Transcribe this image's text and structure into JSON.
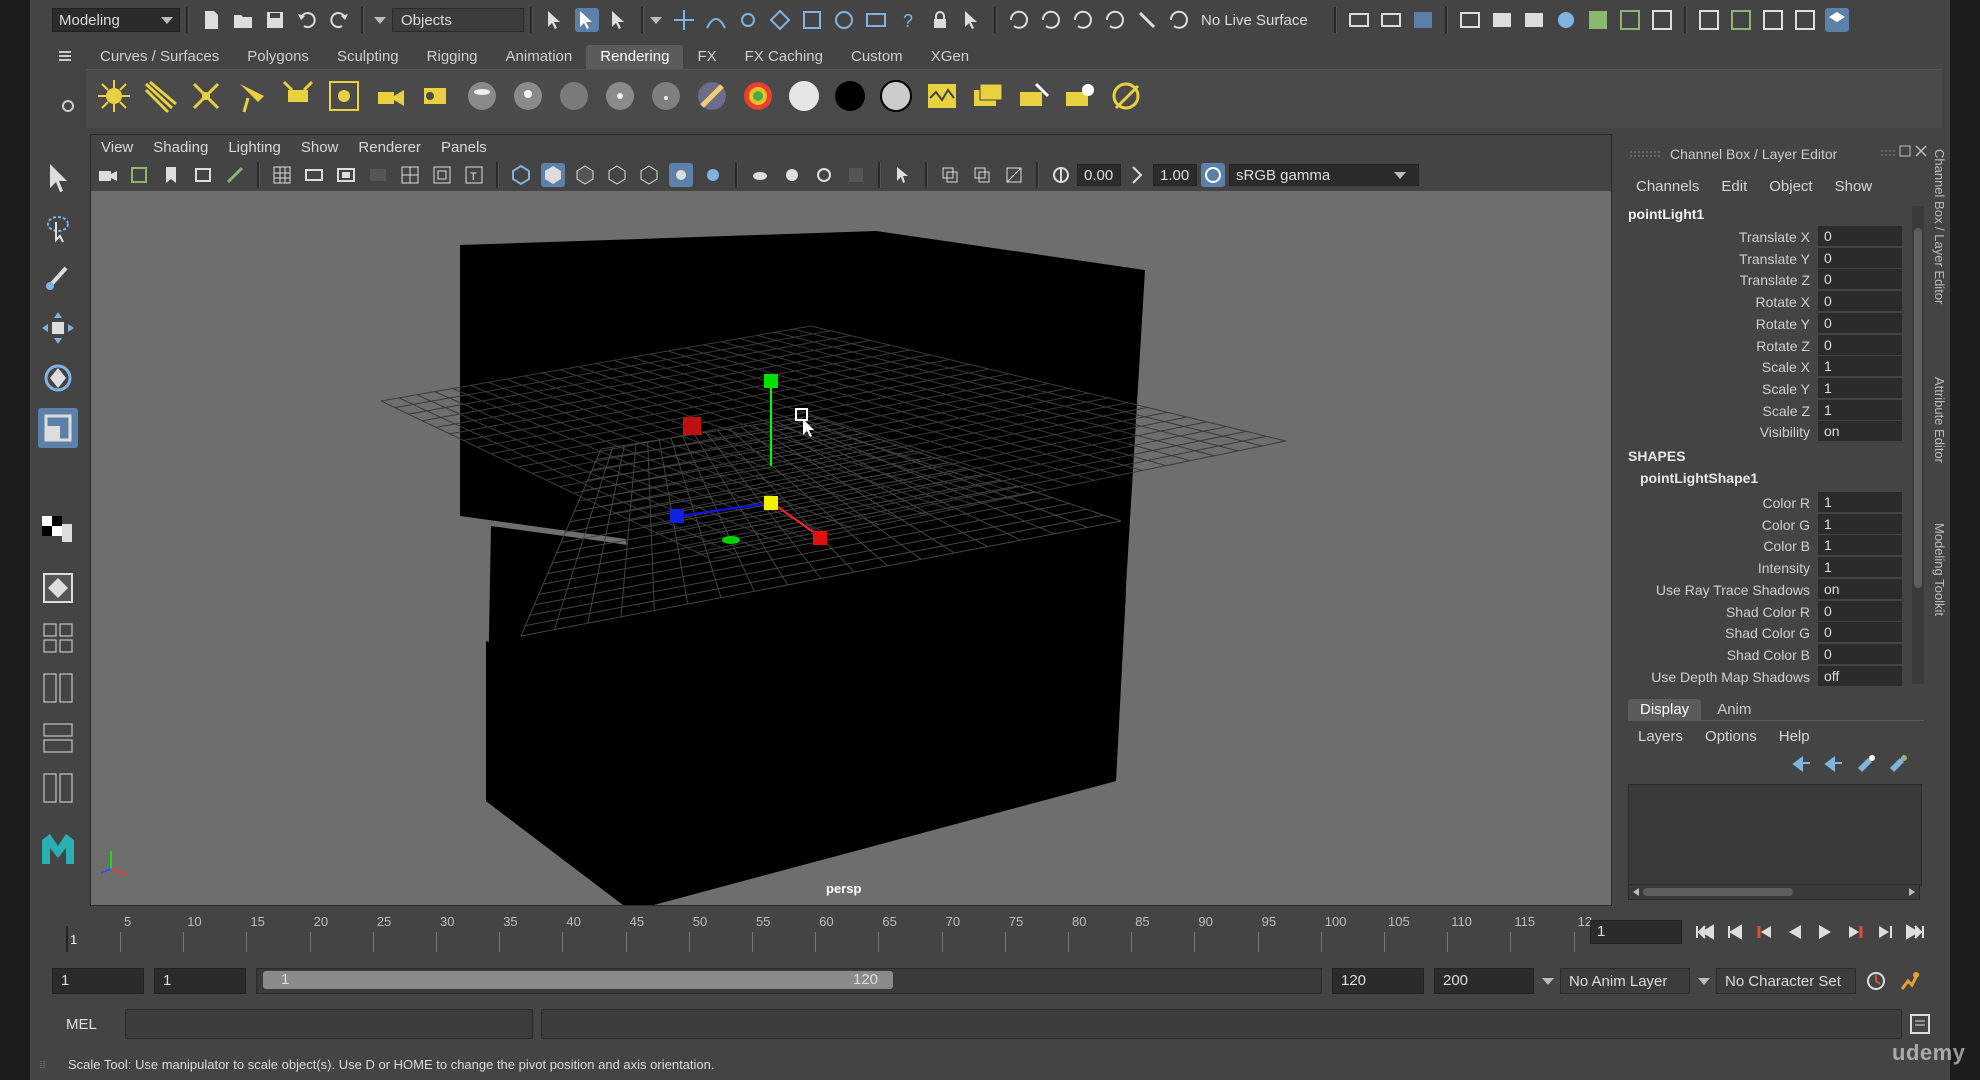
{
  "status_line": {
    "mode": "Modeling",
    "selection_mode": "Objects",
    "live_surface": "No Live Surface"
  },
  "shelf": {
    "tabs": [
      "Curves / Surfaces",
      "Polygons",
      "Sculpting",
      "Rigging",
      "Animation",
      "Rendering",
      "FX",
      "FX Caching",
      "Custom",
      "XGen"
    ],
    "active_tab": "Rendering"
  },
  "viewport": {
    "menu": [
      "View",
      "Shading",
      "Lighting",
      "Show",
      "Renderer",
      "Panels"
    ],
    "exposure": "0.00",
    "gamma": "1.00",
    "color_space": "sRGB gamma",
    "camera": "persp"
  },
  "channel_box": {
    "title": "Channel Box / Layer Editor",
    "menu": [
      "Channels",
      "Edit",
      "Object",
      "Show"
    ],
    "object": "pointLight1",
    "attributes": [
      {
        "label": "Translate X",
        "value": "0"
      },
      {
        "label": "Translate Y",
        "value": "0"
      },
      {
        "label": "Translate Z",
        "value": "0"
      },
      {
        "label": "Rotate X",
        "value": "0"
      },
      {
        "label": "Rotate Y",
        "value": "0"
      },
      {
        "label": "Rotate Z",
        "value": "0"
      },
      {
        "label": "Scale X",
        "value": "1"
      },
      {
        "label": "Scale Y",
        "value": "1"
      },
      {
        "label": "Scale Z",
        "value": "1"
      },
      {
        "label": "Visibility",
        "value": "on"
      }
    ],
    "shapes_header": "SHAPES",
    "shape_name": "pointLightShape1",
    "shape_attributes": [
      {
        "label": "Color R",
        "value": "1"
      },
      {
        "label": "Color G",
        "value": "1"
      },
      {
        "label": "Color B",
        "value": "1"
      },
      {
        "label": "Intensity",
        "value": "1"
      },
      {
        "label": "Use Ray Trace Shadows",
        "value": "on"
      },
      {
        "label": "Shad Color R",
        "value": "0"
      },
      {
        "label": "Shad Color G",
        "value": "0"
      },
      {
        "label": "Shad Color B",
        "value": "0"
      },
      {
        "label": "Use Depth Map Shadows",
        "value": "off"
      }
    ],
    "side_tabs": [
      "Channel Box / Layer Editor",
      "Attribute Editor",
      "Modeling Toolkit"
    ]
  },
  "layer_editor": {
    "tabs": [
      "Display",
      "Anim"
    ],
    "active_tab": "Display",
    "menu": [
      "Layers",
      "Options",
      "Help"
    ]
  },
  "timeline": {
    "ticks": [
      "5",
      "10",
      "15",
      "20",
      "25",
      "30",
      "35",
      "40",
      "45",
      "50",
      "55",
      "60",
      "65",
      "70",
      "75",
      "80",
      "85",
      "90",
      "95",
      "100",
      "105",
      "110",
      "115",
      "12"
    ],
    "start_label": "1",
    "current_frame": "1"
  },
  "range": {
    "start": "1",
    "playback_start": "1",
    "slider_start": "1",
    "slider_end": "120",
    "playback_end": "120",
    "end": "200",
    "anim_layer": "No Anim Layer",
    "character_set": "No Character Set"
  },
  "command_line": {
    "language": "MEL"
  },
  "help_line": "Scale Tool: Use manipulator to scale object(s). Use D or HOME to change the pivot position and axis orientation.",
  "watermark": "udemy"
}
